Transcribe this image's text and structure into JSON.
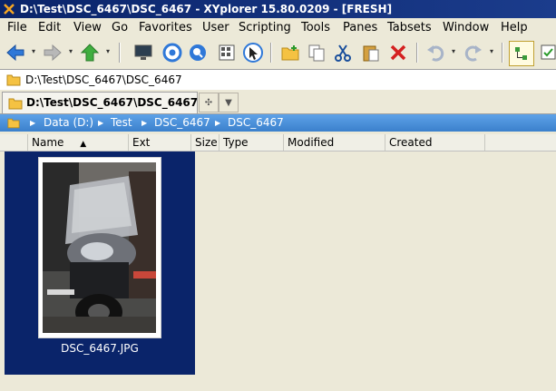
{
  "window": {
    "title": "D:\\Test\\DSC_6467\\DSC_6467 - XYplorer 15.80.0209 - [FRESH]"
  },
  "menu": [
    "File",
    "Edit",
    "View",
    "Go",
    "Favorites",
    "User",
    "Scripting",
    "Tools",
    "Panes",
    "Tabsets",
    "Window",
    "Help"
  ],
  "toolbar": {
    "icons": [
      "back-arrow-icon",
      "forward-arrow-icon",
      "up-arrow-icon",
      "monitor-icon",
      "target-icon",
      "find-icon",
      "thumbnail-view-icon",
      "cursor-icon",
      "new-folder-icon",
      "copy-icon",
      "cut-icon",
      "paste-icon",
      "delete-icon",
      "undo-icon",
      "redo-icon",
      "tree-icon",
      "checkbox-icon"
    ]
  },
  "address": {
    "path": "D:\\Test\\DSC_6467\\DSC_6467"
  },
  "tab": {
    "label": "D:\\Test\\DSC_6467\\DSC_6467"
  },
  "breadcrumb": [
    "Data (D:)",
    "Test",
    "DSC_6467",
    "DSC_6467"
  ],
  "columns": {
    "name": "Name",
    "sort_indicator": "▲",
    "ext": "Ext",
    "size": "Size",
    "type": "Type",
    "modified": "Modified",
    "created": "Created"
  },
  "files": [
    {
      "name": "DSC_6467.JPG"
    }
  ],
  "colors": {
    "title_bg": "#0a246a",
    "breadcrumb_bg": "#4a90d9",
    "selection_bg": "#0a246a"
  }
}
